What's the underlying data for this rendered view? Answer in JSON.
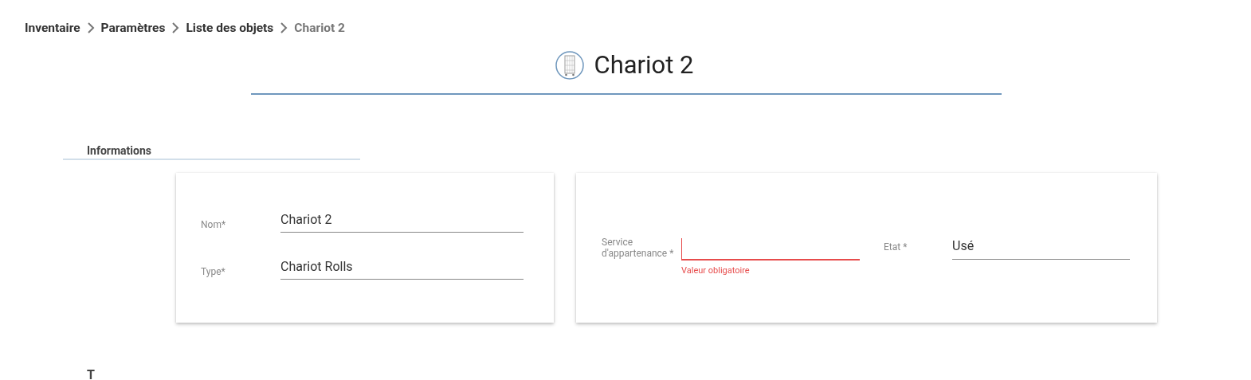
{
  "breadcrumb": [
    {
      "label": "Inventaire",
      "current": false
    },
    {
      "label": "Paramètres",
      "current": false
    },
    {
      "label": "Liste des objets",
      "current": false
    },
    {
      "label": "Chariot 2",
      "current": true
    }
  ],
  "header": {
    "title": "Chariot 2"
  },
  "section": {
    "title": "Informations"
  },
  "cards": [
    {
      "fields": [
        {
          "label": "Nom*",
          "value": "Chariot 2",
          "error": false
        },
        {
          "label": "Type*",
          "value": "Chariot Rolls",
          "error": false
        }
      ]
    },
    {
      "fields": [
        {
          "label": "Service d'appartenance *",
          "error": true,
          "error_text": "Valeur obligatoire"
        },
        {
          "label": "Etat *",
          "value": "Usé",
          "error": false
        }
      ]
    }
  ],
  "next_section": {
    "title": "T"
  }
}
